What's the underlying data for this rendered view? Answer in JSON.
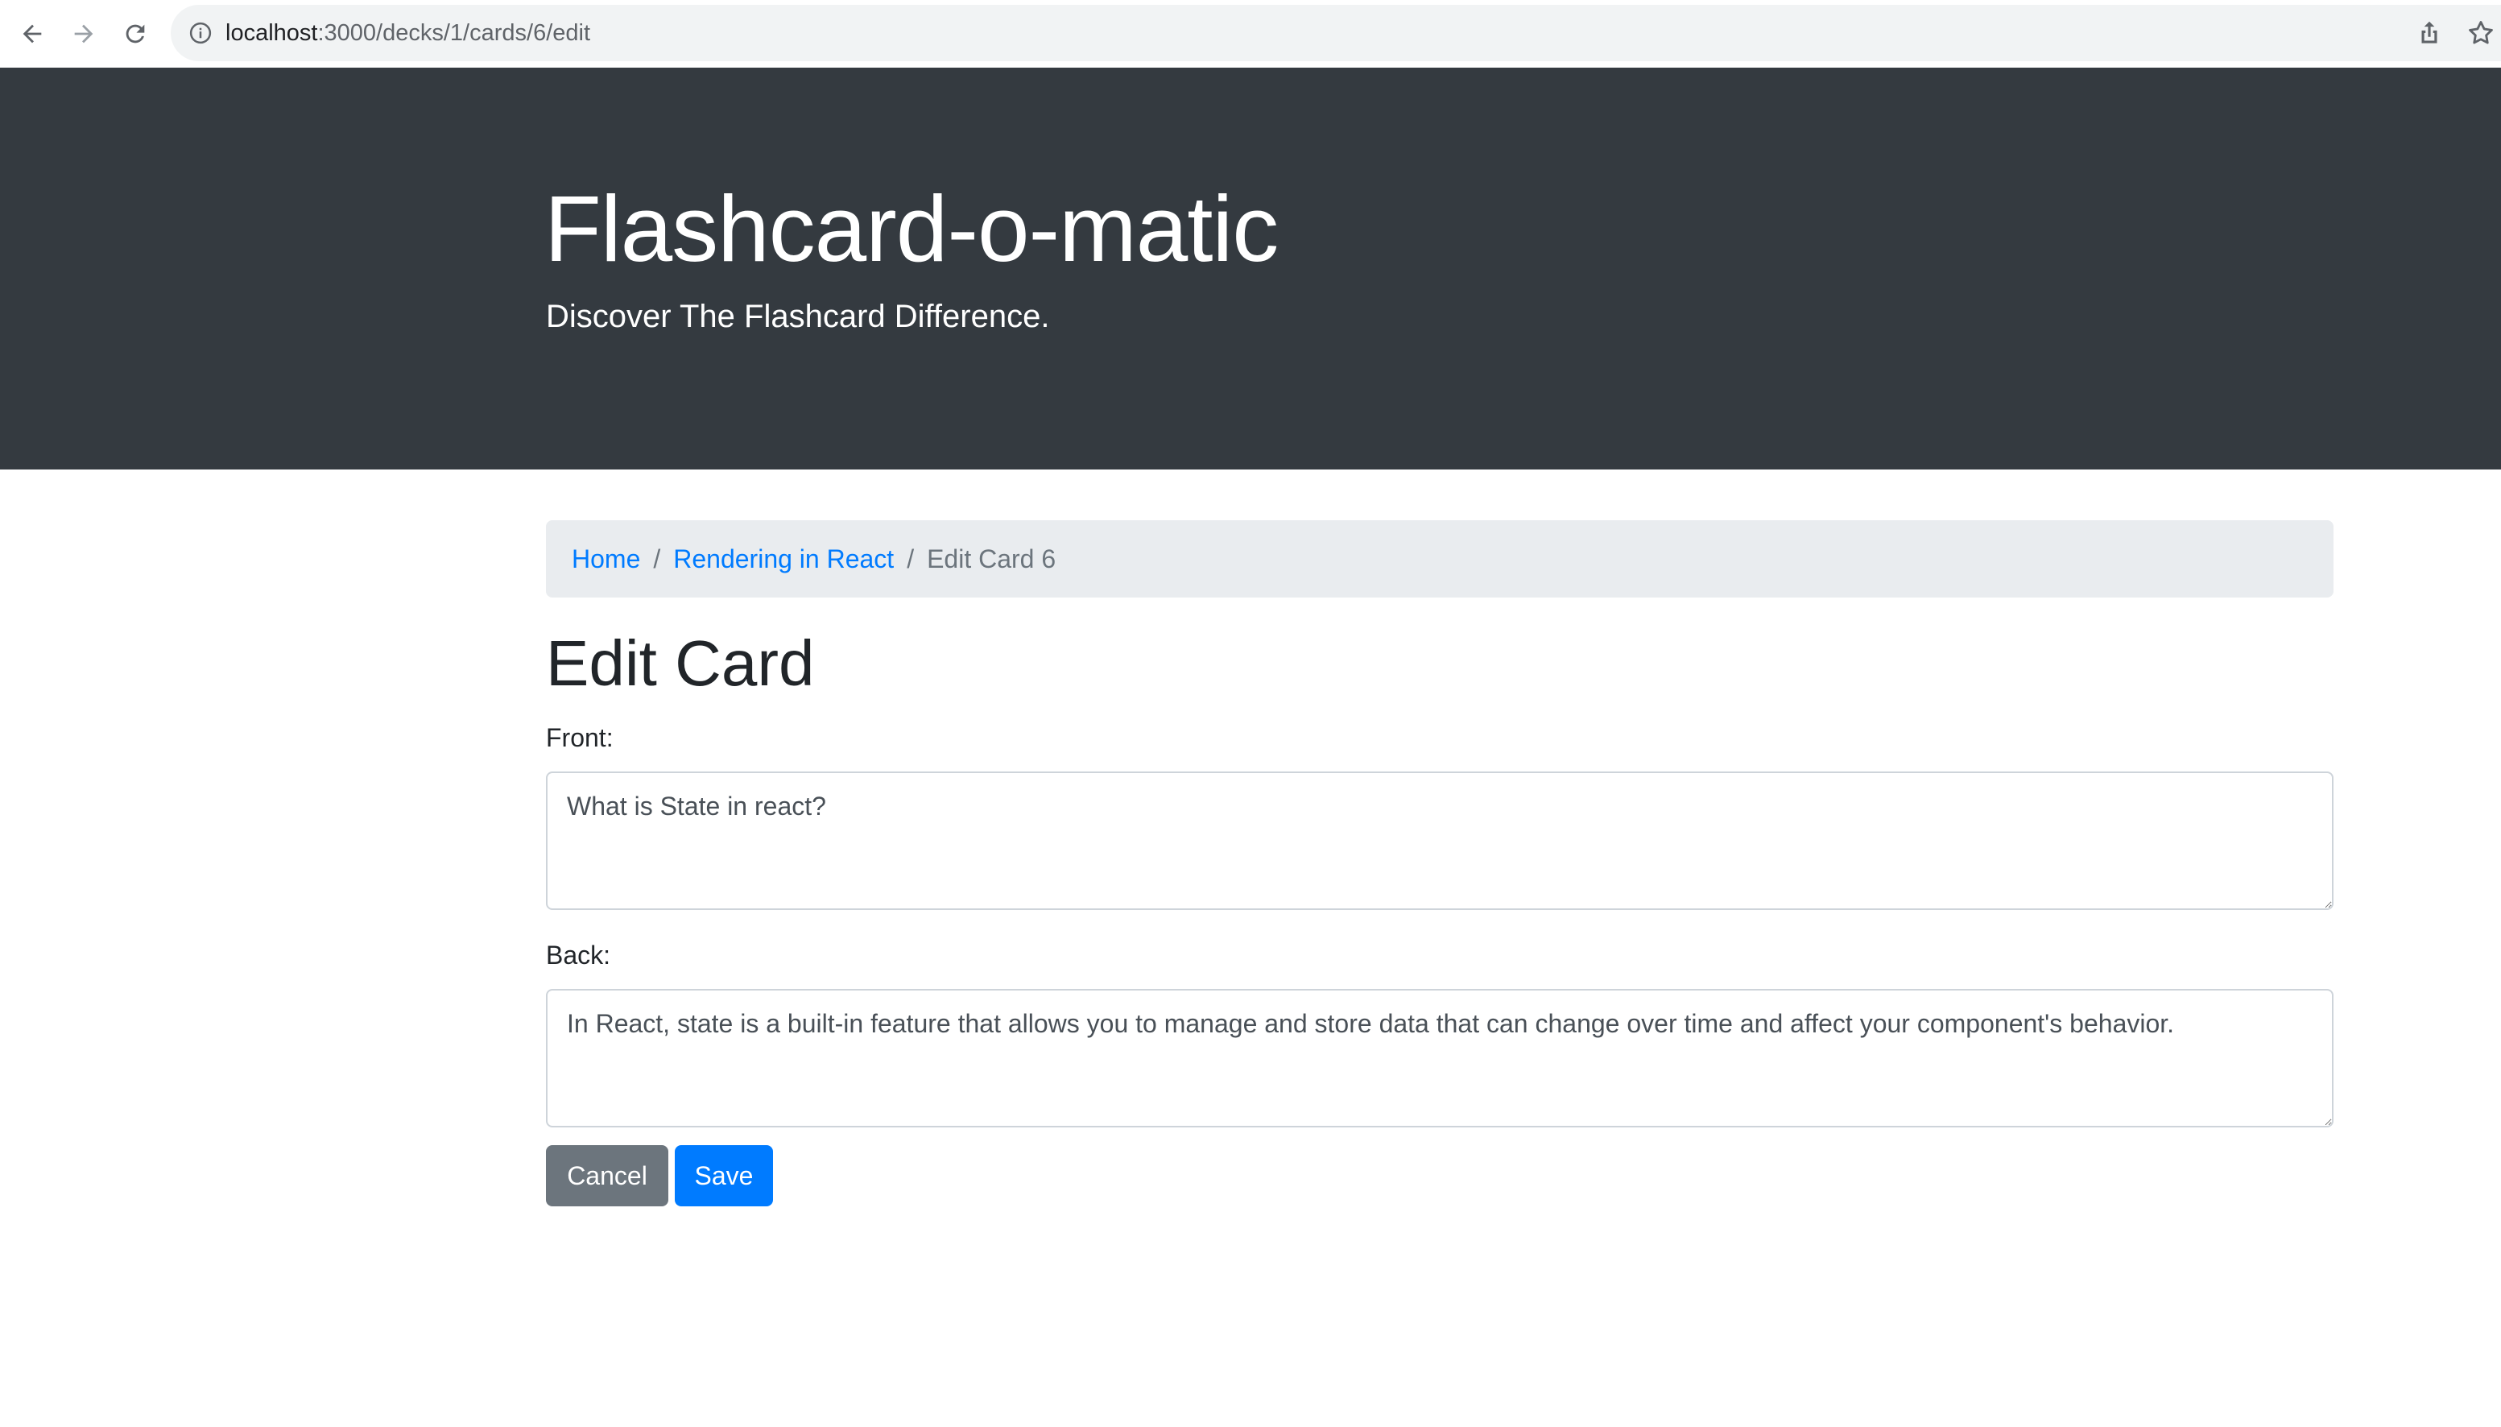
{
  "browser": {
    "url_host": "localhost",
    "url_path": ":3000/decks/1/cards/6/edit",
    "back_icon": "back-arrow-icon",
    "forward_icon": "forward-arrow-icon",
    "reload_icon": "reload-icon",
    "site_info_icon": "info-icon",
    "share_icon": "share-icon",
    "bookmark_icon": "star-icon"
  },
  "header": {
    "title": "Flashcard-o-matic",
    "tagline": "Discover The Flashcard Difference.",
    "background": "#343a40"
  },
  "breadcrumb": {
    "items": [
      {
        "label": "Home"
      },
      {
        "label": "Rendering in React"
      },
      {
        "label": "Edit Card 6"
      }
    ],
    "separator": "/"
  },
  "page": {
    "title": "Edit Card"
  },
  "form": {
    "front_label": "Front:",
    "front_value": "What is State in react?",
    "back_label": "Back:",
    "back_value": "In React, state is a built-in feature that allows you to manage and store data that can change over time and affect your component's behavior.",
    "cancel_label": "Cancel",
    "save_label": "Save"
  },
  "colors": {
    "primary": "#007bff",
    "secondary": "#6c757d",
    "breadcrumb_bg": "#e9ecef"
  }
}
